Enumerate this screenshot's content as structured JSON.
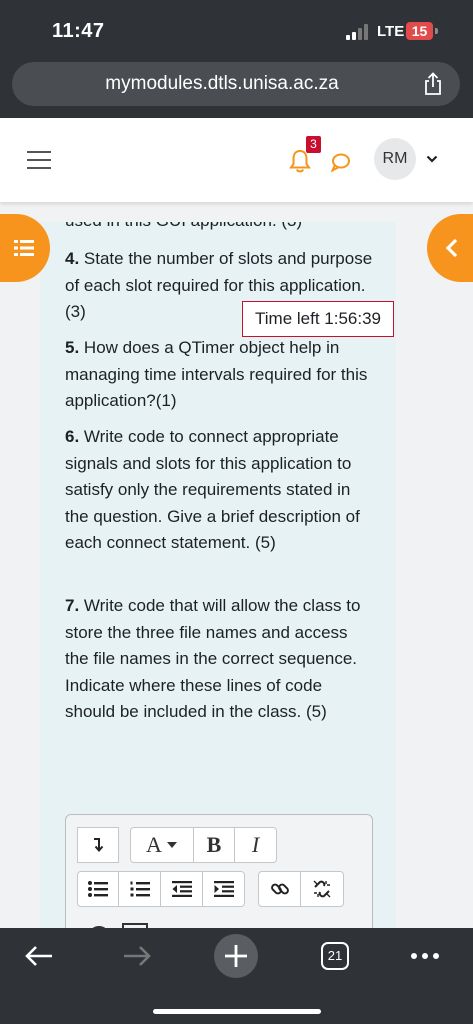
{
  "status": {
    "time": "11:47",
    "network": "LTE",
    "battery": "15"
  },
  "browser": {
    "url": "mymodules.dtls.unisa.ac.za",
    "tab_count": "21"
  },
  "header": {
    "notification_count": "3",
    "user_initials": "RM"
  },
  "timer": {
    "text": "Time left 1:56:39"
  },
  "questions": {
    "partial_top": "used in this GUI application.  (3)",
    "q4": {
      "num": "4.",
      "text": " State the number of slots and purpose of each slot required for this application. (3)"
    },
    "q5": {
      "num": "5.",
      "text": " How does a QTimer object help in managing time intervals required for this application?(1)"
    },
    "q6": {
      "num": "6.",
      "text": " Write code to connect appropriate signals and slots for this application to satisfy only the requirements stated in the question. Give a brief description of each connect statement. (5)"
    },
    "q7": {
      "num": "7.",
      "text": " Write code that will allow the class to store the three file names and access the file names in the correct sequence. Indicate where these lines of code should be included in the class. (5)"
    }
  },
  "editor": {
    "font_label": "A",
    "bold_label": "B",
    "italic_label": "I"
  },
  "colors": {
    "accent": "#f7941d",
    "badge": "#c8102e",
    "card": "#e6f2f4"
  }
}
